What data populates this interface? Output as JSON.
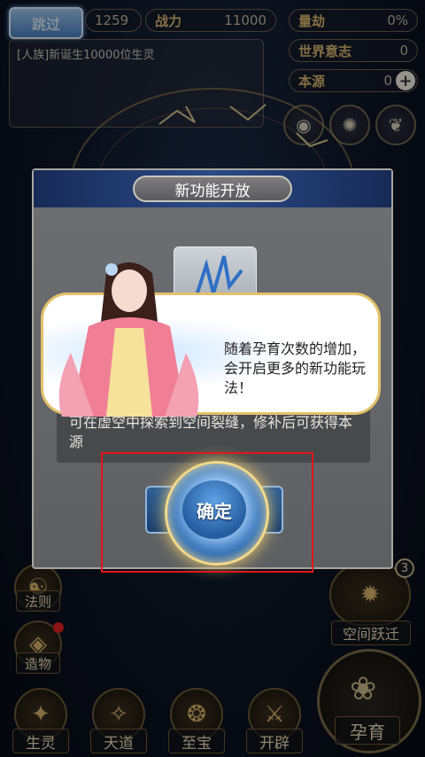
{
  "hud": {
    "skip_label": "跳过",
    "stat1_value": "1259",
    "power_label": "战力",
    "power_value": "11000",
    "calamity_label": "量劫",
    "calamity_value": "0%",
    "world_will_label": "世界意志",
    "world_will_value": "0",
    "origin_label": "本源",
    "origin_value": "0",
    "plus_symbol": "+"
  },
  "log": {
    "line": "[人族]新诞生10000位生灵"
  },
  "dialog": {
    "title": "新功能开放",
    "description": "可在虚空中探索到空间裂缝，修补后可获得本源",
    "confirm_label": "确定"
  },
  "guide": {
    "text": "随着孕育次数的增加，会开启更多的新功能玩法！"
  },
  "left_menu": {
    "law_label": "法则",
    "create_label": "造物"
  },
  "right_menu": {
    "space_jump_label": "空间跃迁",
    "space_jump_badge": "3"
  },
  "bottom_nav": [
    {
      "label": "生灵"
    },
    {
      "label": "天道"
    },
    {
      "label": "至宝"
    },
    {
      "label": "开辟"
    }
  ],
  "gestate": {
    "label": "孕育"
  },
  "colors": {
    "highlight": "#e01818",
    "gold": "#e2c16a",
    "accent_blue": "#4b7fc0"
  }
}
